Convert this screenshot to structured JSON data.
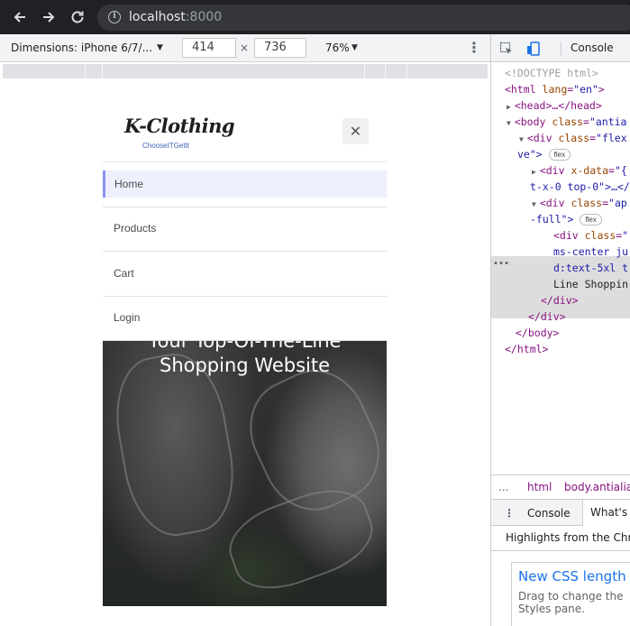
{
  "browser": {
    "url_host": "localhost",
    "url_port": ":8000",
    "back_icon": "arrow-left-icon",
    "forward_icon": "arrow-right-icon",
    "reload_icon": "reload-icon"
  },
  "device_toolbar": {
    "dimensions_label": "Dimensions: iPhone 6/7/...",
    "width_value": "414",
    "height_value": "736",
    "times": "×",
    "zoom_label": "76%",
    "more_icon": "more-vert-icon"
  },
  "app": {
    "logo_title": "K-Clothing",
    "logo_tagline": "ChooseITGetIt",
    "close_icon": "close-icon",
    "menu": [
      {
        "label": "Home",
        "active": true
      },
      {
        "label": "Products",
        "active": false
      },
      {
        "label": "Cart",
        "active": false
      },
      {
        "label": "Login",
        "active": false
      }
    ],
    "hero_line1": "Your Top-Of-The-Line",
    "hero_line2": "Shopping Website"
  },
  "devtools": {
    "tab_console": "Console",
    "elements": {
      "doctype": "<!DOCTYPE html>",
      "html_open_tag": "<html ",
      "html_attr": "lang",
      "html_val": "\"en\"",
      "html_close_bracket": ">",
      "head": "<head>…</head>",
      "body_tag": "<body ",
      "body_attr": "class",
      "body_val": "\"antia",
      "div1_tag": "<div ",
      "div1_attr": "class",
      "div1_val": "\"flex",
      "div1_cont": "ve\">",
      "div2_tag": "<div ",
      "div2_attr": "x-data",
      "div2_val": "\"{",
      "div2_cont": "t-x-0 top-0\">…</",
      "div3_tag": "<div ",
      "div3_attr": "class",
      "div3_val": "\"ap",
      "div3_cont": "-full\">",
      "div4_tag": "<div ",
      "div4_attr": "class",
      "div4_val": "\"",
      "div4_line2": "ms-center ju",
      "div4_line3": "d:text-5xl t",
      "div4_line4": "Line Shoppin",
      "div_close1": "</div>",
      "div_close2": "</div>",
      "body_close": "</body>",
      "html_close": "</html>",
      "flex_badge": "flex"
    },
    "breadcrumbs": [
      "...",
      "html",
      "body.antialia"
    ],
    "drawer_tabs": [
      "Console",
      "What's N"
    ],
    "highlights": "Highlights from the Chro",
    "whats_new_title": "New CSS length au",
    "whats_new_body": "Drag to change the\nStyles pane."
  }
}
